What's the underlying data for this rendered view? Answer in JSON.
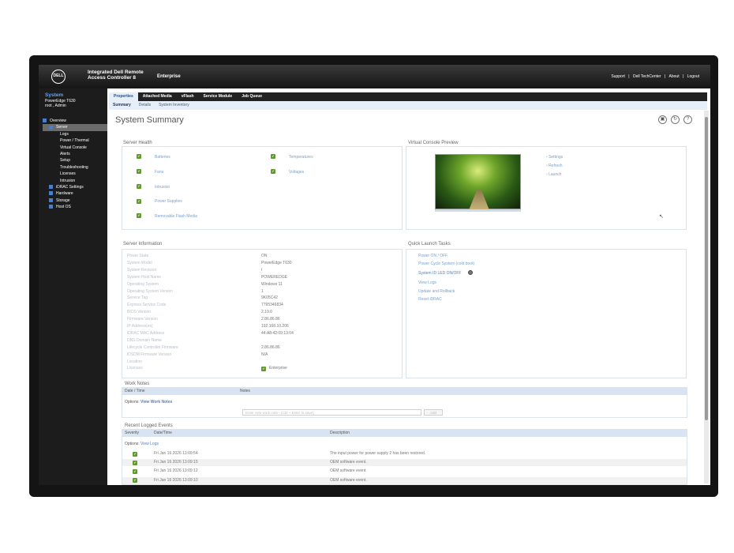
{
  "banner": {
    "logo": "DELL",
    "product_line1": "Integrated Dell Remote",
    "product_line2": "Access Controller 8",
    "edition": "Enterprise",
    "links": [
      "Support",
      "|",
      "Dell TechCenter",
      "|",
      "About",
      "|",
      "Logout"
    ]
  },
  "sidebar": {
    "title": "System",
    "model": "PowerEdge T630",
    "user": "root , Admin",
    "tree": [
      {
        "label": "Overview",
        "level": 0,
        "expander": true
      },
      {
        "label": "Server",
        "level": 1,
        "expander": true,
        "selected": true
      },
      {
        "label": "Logs",
        "level": 2
      },
      {
        "label": "Power / Thermal",
        "level": 2
      },
      {
        "label": "Virtual Console",
        "level": 2
      },
      {
        "label": "Alerts",
        "level": 2
      },
      {
        "label": "Setup",
        "level": 2
      },
      {
        "label": "Troubleshooting",
        "level": 2
      },
      {
        "label": "Licenses",
        "level": 2
      },
      {
        "label": "Intrusion",
        "level": 2
      },
      {
        "label": "iDRAC Settings",
        "level": 1,
        "expander": true
      },
      {
        "label": "Hardware",
        "level": 1,
        "expander": true
      },
      {
        "label": "Storage",
        "level": 1,
        "expander": true
      },
      {
        "label": "Host OS",
        "level": 1,
        "expander": true
      }
    ]
  },
  "tabs": [
    "Properties",
    "Attached Media",
    "vFlash",
    "Service Module",
    "Job Queue"
  ],
  "subtabs": [
    "Summary",
    "Details",
    "System Inventory"
  ],
  "page_title": "System Summary",
  "title_icons": [
    "print-icon",
    "refresh-icon",
    "help-icon"
  ],
  "title_icon_glyphs": [
    "▣",
    "↻",
    "?"
  ],
  "server_health": {
    "title": "Server Health",
    "items_left": [
      "Batteries",
      "Fans",
      "Intrusion",
      "Power Supplies",
      "Removable Flash Media"
    ],
    "items_right": [
      "Temperatures",
      "Voltages"
    ],
    "status_color": "#5f9a2a"
  },
  "console_preview": {
    "title": "Virtual Console Preview",
    "links": [
      "Settings",
      "Refresh",
      "Launch"
    ],
    "bullet": "›"
  },
  "server_info": {
    "title": "Server Information",
    "rows": [
      {
        "label": "Power State",
        "value": "ON"
      },
      {
        "label": "System Model",
        "value": "PowerEdge T630"
      },
      {
        "label": "System Revision",
        "value": "I"
      },
      {
        "label": "System Host Name",
        "value": "POWEREDGE"
      },
      {
        "label": "Operating System",
        "value": "Windows 11"
      },
      {
        "label": "Operating System Version",
        "value": "1"
      },
      {
        "label": "Service Tag",
        "value": "9K05C42"
      },
      {
        "label": "Express Service Code",
        "value": "7795346834"
      },
      {
        "label": "BIOS Version",
        "value": "2.19.0"
      },
      {
        "label": "Firmware Version",
        "value": "2.86.86.86"
      },
      {
        "label": "IP Address(es)",
        "value": "192.168.10.206"
      },
      {
        "label": "iDRAC MAC Address",
        "value": "44:A8:42:09:13:04"
      },
      {
        "label": "DNS Domain Name",
        "value": ""
      },
      {
        "label": "Lifecycle Controller Firmware",
        "value": "2.86.86.86"
      },
      {
        "label": "iDSDM Firmware Version",
        "value": "N/A"
      },
      {
        "label": "Location",
        "value": ""
      },
      {
        "label": "Licenses",
        "value": "Enterprise"
      }
    ]
  },
  "quick_launch": {
    "title": "Quick Launch Tasks",
    "tasks": [
      "Power ON / OFF",
      "Power Cycle System (cold boot)",
      "System ID LED ON/OFF",
      "View Logs",
      "Update and Rollback",
      "Reset iDRAC"
    ]
  },
  "work_notes": {
    "title": "Work Notes",
    "col_date": "Date / Time",
    "col_notes": "Notes",
    "options_label": "Options:",
    "options_link": "View Work Notes",
    "input_placeholder": "Enter new work note - (Ctrl + Enter to save)",
    "add_label": "Add"
  },
  "recent_events": {
    "title": "Recent Logged Events",
    "col_severity": "Severity",
    "col_date": "Date/Time",
    "col_desc": "Description",
    "options_label": "Options:",
    "options_link": "View Logs",
    "rows": [
      {
        "date": "Fri Jan 16 2026 13:09:54",
        "desc": "The input power for power supply 2 has been restored."
      },
      {
        "date": "Fri Jan 16 2026 13:09:15",
        "desc": "OEM software event."
      },
      {
        "date": "Fri Jan 16 2026 13:09:12",
        "desc": "OEM software event."
      },
      {
        "date": "Fri Jan 16 2026 13:09:10",
        "desc": "OEM software event."
      }
    ]
  },
  "check_glyph": "✔",
  "cursor_glyph": "↖"
}
